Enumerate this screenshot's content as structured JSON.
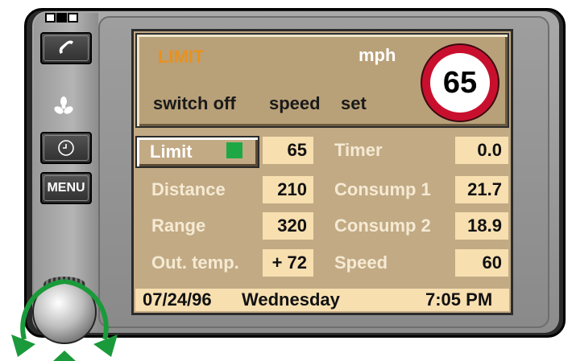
{
  "header": {
    "limit_title": "LIMIT",
    "unit": "mph",
    "sign_value": "65",
    "switch_off_label": "switch off",
    "speed_label": "speed",
    "set_label": "set"
  },
  "side_buttons": {
    "phone_icon": "phone-icon",
    "fan_icon": "fan-icon",
    "clock_icon": "clock-icon",
    "menu_label": "MENU"
  },
  "left_column": [
    {
      "label": "Limit",
      "value": "65"
    },
    {
      "label": "Distance",
      "value": "210"
    },
    {
      "label": "Range",
      "value": "320"
    },
    {
      "label": "Out. temp.",
      "value": "+ 72"
    }
  ],
  "right_column": [
    {
      "label": "Timer",
      "value": "0.0"
    },
    {
      "label": "Consump 1",
      "value": "21.7"
    },
    {
      "label": "Consump 2",
      "value": "18.9"
    },
    {
      "label": "Speed",
      "value": "60"
    }
  ],
  "status_bar": {
    "date": "07/24/96",
    "weekday": "Wednesday",
    "time": "7:05 PM"
  },
  "colors": {
    "screen_bg": "#c2aa85",
    "value_bg": "#f7dfb0",
    "limit_title": "#e8921e",
    "indicator": "#1ea845",
    "sign_ring": "#c8102e",
    "knob_arrows": "#1a9a3a"
  }
}
